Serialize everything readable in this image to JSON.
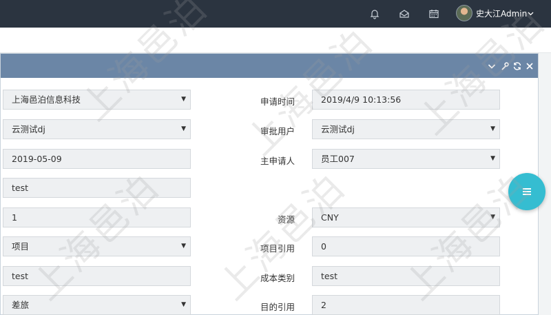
{
  "header": {
    "user_name": "史大江Admin",
    "icons": [
      "bell-icon",
      "mail-icon",
      "calendar-icon",
      "chevron-down-icon"
    ],
    "bg_color": "#2b3440"
  },
  "panel": {
    "header_color": "#6b86a6",
    "tools": [
      "chevron-down-icon",
      "wrench-icon",
      "refresh-icon",
      "close-icon"
    ]
  },
  "form": {
    "left": [
      {
        "value": "上海邑泊信息科技",
        "type": "select"
      },
      {
        "value": "云测试dj",
        "type": "select"
      },
      {
        "value": "2019-05-09",
        "type": "input"
      },
      {
        "value": "test",
        "type": "input"
      },
      {
        "value": "1",
        "type": "input"
      },
      {
        "value": "项目",
        "type": "select"
      },
      {
        "value": "test",
        "type": "input"
      },
      {
        "value": "差旅",
        "type": "select"
      }
    ],
    "right": [
      {
        "label": "申请时间",
        "value": "2019/4/9 10:13:56",
        "type": "input"
      },
      {
        "label": "审批用户",
        "value": "云测试dj",
        "type": "select"
      },
      {
        "label": "主申请人",
        "value": "员工007",
        "type": "select"
      },
      {
        "label": "资源",
        "value": "CNY",
        "type": "select"
      },
      {
        "label": "项目引用",
        "value": "0",
        "type": "input"
      },
      {
        "label": "成本类别",
        "value": "test",
        "type": "input"
      },
      {
        "label": "目的引用",
        "value": "2",
        "type": "input"
      }
    ]
  },
  "watermark_text": "上海邑泊",
  "fab": {
    "icon": "menu-icon",
    "color": "#35bdd1"
  }
}
